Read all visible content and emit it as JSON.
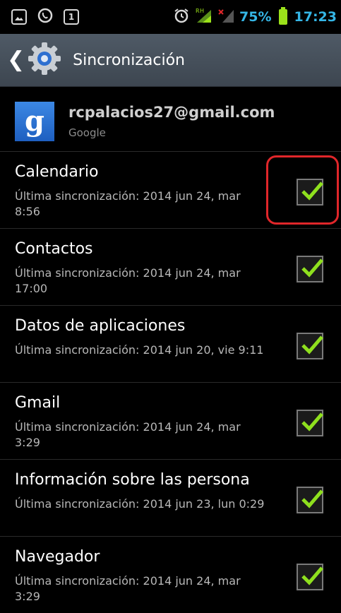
{
  "status_bar": {
    "battery_percent": "75%",
    "time": "17:23",
    "colors": {
      "accent": "#35b6e6",
      "battery": "#9be11a"
    },
    "icons": [
      "image-icon",
      "whatsapp-icon",
      "calendar-icon",
      "alarm-icon",
      "signal-icon",
      "signal-off-icon"
    ]
  },
  "header": {
    "title": "Sincronización",
    "back_icon": "chevron-left-icon",
    "gear_icon": "gear-icon"
  },
  "account": {
    "email": "rcpalacios27@gmail.com",
    "type": "Google",
    "logo_letter": "g"
  },
  "sync_items": [
    {
      "title": "Calendario",
      "last_sync": "Última sincronización: 2014 jun 24, mar 8:56",
      "checked": true
    },
    {
      "title": "Contactos",
      "last_sync": "Última sincronización: 2014 jun 24, mar 17:00",
      "checked": true
    },
    {
      "title": "Datos de aplicaciones",
      "last_sync": "Última sincronización: 2014 jun 20, vie 9:11",
      "checked": true
    },
    {
      "title": "Gmail",
      "last_sync": "Última sincronización: 2014 jun 24, mar 3:29",
      "checked": true
    },
    {
      "title": "Información sobre las persona",
      "last_sync": "Última sincronización: 2014 jun 23, lun 0:29",
      "checked": true
    },
    {
      "title": "Navegador",
      "last_sync": "Última sincronización: 2014 jun 24, mar 3:29",
      "checked": true
    }
  ],
  "highlight_color": "#e0262a"
}
